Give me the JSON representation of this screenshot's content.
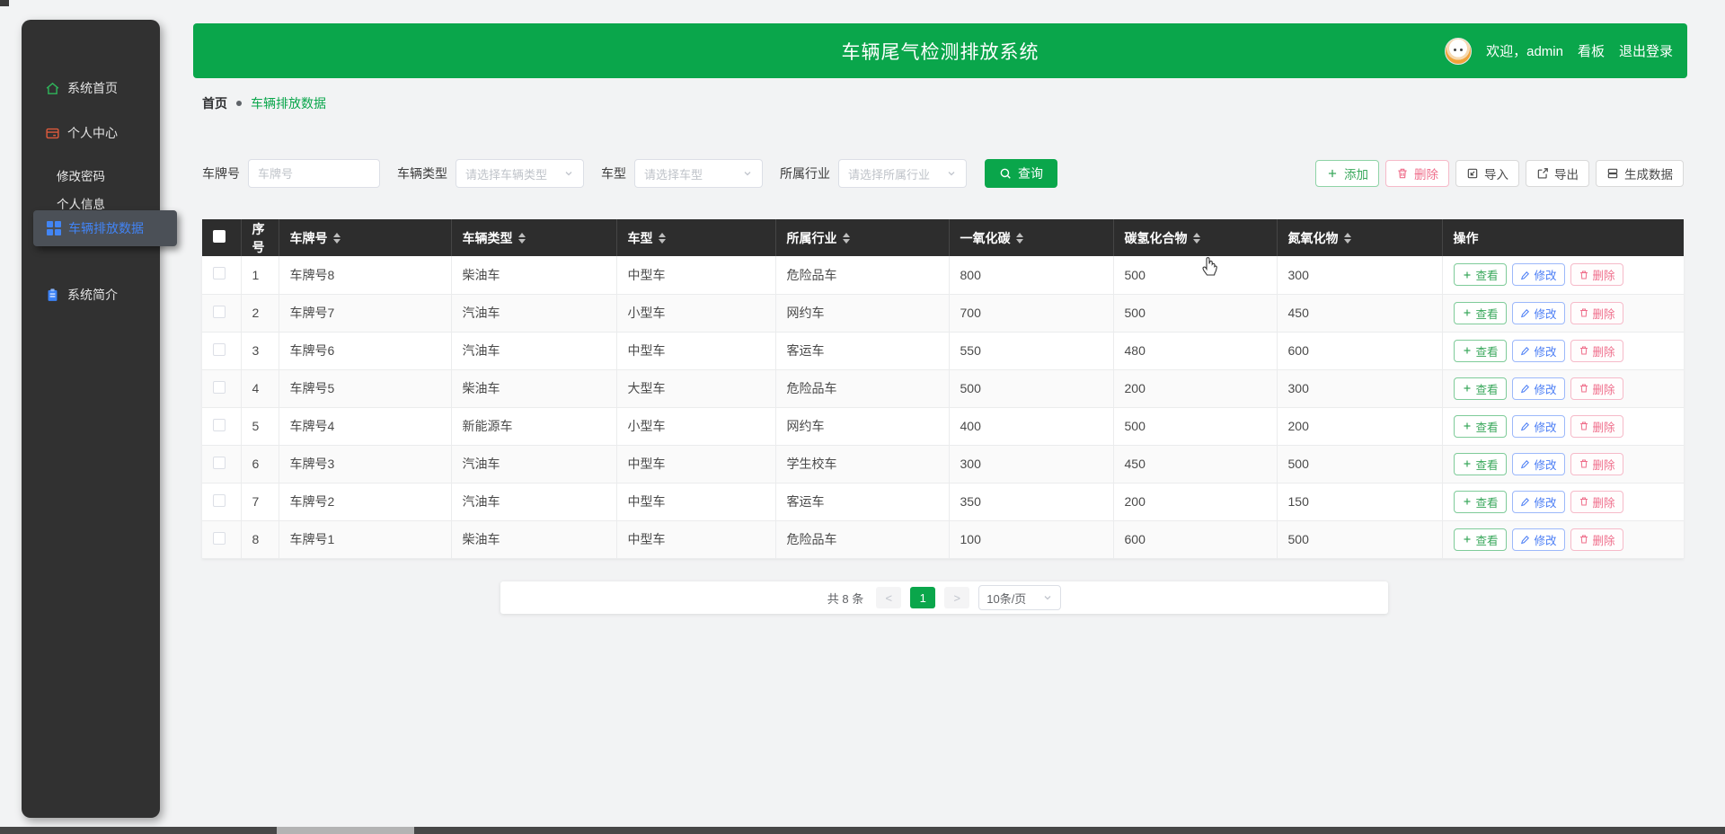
{
  "header": {
    "title": "车辆尾气检测排放系统",
    "welcome": "欢迎，admin",
    "kanban_link": "看板",
    "logout_link": "退出登录"
  },
  "sidebar": {
    "items": [
      {
        "label": "系统首页",
        "icon": "home-icon"
      },
      {
        "label": "个人中心",
        "icon": "profile-card-icon"
      },
      {
        "label": "修改密码"
      },
      {
        "label": "个人信息"
      },
      {
        "label": "车辆排放数据",
        "icon": "grid-icon",
        "active": true
      },
      {
        "label": "系统简介",
        "icon": "clipboard-icon"
      }
    ]
  },
  "breadcrumb": {
    "home": "首页",
    "current": "车辆排放数据"
  },
  "filters": {
    "plate_label": "车牌号",
    "plate_placeholder": "车牌号",
    "vehicle_type_label": "车辆类型",
    "vehicle_type_placeholder": "请选择车辆类型",
    "model_label": "车型",
    "model_placeholder": "请选择车型",
    "industry_label": "所属行业",
    "industry_placeholder": "请选择所属行业",
    "search_label": "查询"
  },
  "toolbar": {
    "add": "添加",
    "delete": "删除",
    "import": "导入",
    "export": "导出",
    "generate": "生成数据"
  },
  "table": {
    "headers": [
      "序号",
      "车牌号",
      "车辆类型",
      "车型",
      "所属行业",
      "一氧化碳",
      "碳氢化合物",
      "氮氧化物",
      "操作"
    ],
    "rows": [
      {
        "index": "1",
        "plate": "车牌号8",
        "vehicle_type": "柴油车",
        "model": "中型车",
        "industry": "危险品车",
        "co": "800",
        "hc": "500",
        "nox": "300"
      },
      {
        "index": "2",
        "plate": "车牌号7",
        "vehicle_type": "汽油车",
        "model": "小型车",
        "industry": "网约车",
        "co": "700",
        "hc": "500",
        "nox": "450"
      },
      {
        "index": "3",
        "plate": "车牌号6",
        "vehicle_type": "汽油车",
        "model": "中型车",
        "industry": "客运车",
        "co": "550",
        "hc": "480",
        "nox": "600"
      },
      {
        "index": "4",
        "plate": "车牌号5",
        "vehicle_type": "柴油车",
        "model": "大型车",
        "industry": "危险品车",
        "co": "500",
        "hc": "200",
        "nox": "300"
      },
      {
        "index": "5",
        "plate": "车牌号4",
        "vehicle_type": "新能源车",
        "model": "小型车",
        "industry": "网约车",
        "co": "400",
        "hc": "500",
        "nox": "200"
      },
      {
        "index": "6",
        "plate": "车牌号3",
        "vehicle_type": "汽油车",
        "model": "中型车",
        "industry": "学生校车",
        "co": "300",
        "hc": "450",
        "nox": "500"
      },
      {
        "index": "7",
        "plate": "车牌号2",
        "vehicle_type": "汽油车",
        "model": "中型车",
        "industry": "客运车",
        "co": "350",
        "hc": "200",
        "nox": "150"
      },
      {
        "index": "8",
        "plate": "车牌号1",
        "vehicle_type": "柴油车",
        "model": "中型车",
        "industry": "危险品车",
        "co": "100",
        "hc": "600",
        "nox": "500"
      }
    ],
    "actions": {
      "view": "查看",
      "edit": "修改",
      "delete": "删除"
    }
  },
  "pagination": {
    "total": "共 8 条",
    "prev": "<",
    "page": "1",
    "next": ">",
    "page_size": "10条/页"
  },
  "colors": {
    "primary_green": "#0aa64b",
    "header_dark": "#2d2d2d",
    "sidebar_dark": "#313131",
    "action_blue": "#4a7df5",
    "action_rose": "#ef6e8b",
    "action_green": "#3aa85c"
  }
}
